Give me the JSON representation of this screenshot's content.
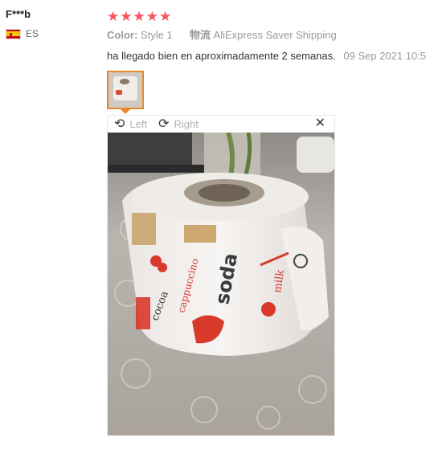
{
  "user": {
    "name": "F***b",
    "country_code": "ES",
    "flag_icon": "spain-flag-icon"
  },
  "rating": {
    "stars": 5,
    "max": 5,
    "color": "#f4545b"
  },
  "meta": {
    "color_label": "Color:",
    "color_value": "Style 1",
    "shipping_label": "物流",
    "shipping_value": "AliExpress Saver Shipping"
  },
  "feedback": {
    "text": "ha llegado bien en aproximadamente 2 semanas.",
    "date": "09 Sep 2021 10:5"
  },
  "viewer": {
    "rotate_left_label": "Left",
    "rotate_right_label": "Right",
    "rotate_left_icon": "rotate-left-icon",
    "rotate_right_icon": "rotate-right-icon",
    "close_icon": "close-icon"
  },
  "colors": {
    "thumb_border": "#e58a2a",
    "muted_text": "#999999"
  }
}
